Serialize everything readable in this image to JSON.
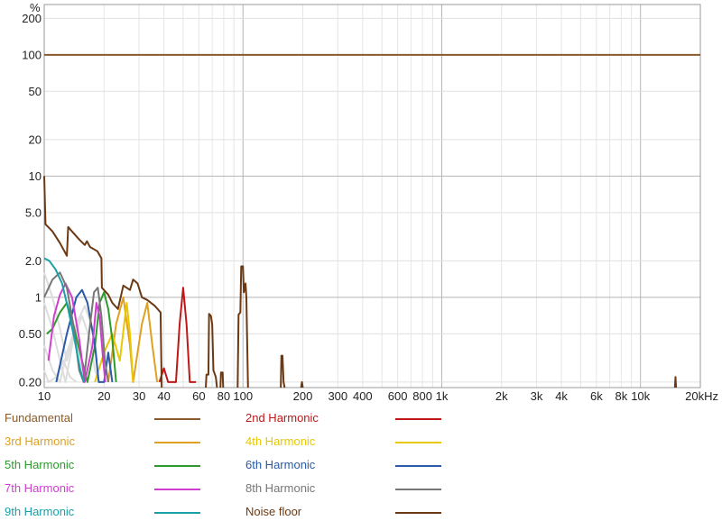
{
  "chart_data": {
    "type": "line",
    "y_unit": "%",
    "x_scale": "log",
    "y_scale": "log",
    "xlim": [
      10,
      20000
    ],
    "ylim": [
      0.18,
      260
    ],
    "x_ticks": [
      {
        "v": 10,
        "label": "10"
      },
      {
        "v": 20,
        "label": "20"
      },
      {
        "v": 30,
        "label": "30"
      },
      {
        "v": 40,
        "label": "40"
      },
      {
        "v": 60,
        "label": "60"
      },
      {
        "v": 80,
        "label": "80"
      },
      {
        "v": 100,
        "label": "100"
      },
      {
        "v": 200,
        "label": "200"
      },
      {
        "v": 300,
        "label": "300"
      },
      {
        "v": 400,
        "label": "400"
      },
      {
        "v": 600,
        "label": "600"
      },
      {
        "v": 800,
        "label": "800"
      },
      {
        "v": 1000,
        "label": "1k"
      },
      {
        "v": 2000,
        "label": "2k"
      },
      {
        "v": 3000,
        "label": "3k"
      },
      {
        "v": 4000,
        "label": "4k"
      },
      {
        "v": 6000,
        "label": "6k"
      },
      {
        "v": 8000,
        "label": "8k"
      },
      {
        "v": 10000,
        "label": "10k"
      },
      {
        "v": 20000,
        "label": "20kHz"
      }
    ],
    "y_ticks": [
      {
        "v": 200,
        "label": "200"
      },
      {
        "v": 100,
        "label": "100"
      },
      {
        "v": 50,
        "label": "50"
      },
      {
        "v": 20,
        "label": "20"
      },
      {
        "v": 10,
        "label": "10"
      },
      {
        "v": 5,
        "label": "5.0"
      },
      {
        "v": 2,
        "label": "2.0"
      },
      {
        "v": 1,
        "label": "1"
      },
      {
        "v": 0.5,
        "label": "0.50"
      },
      {
        "v": 0.2,
        "label": "0.20"
      }
    ],
    "grid": true,
    "legend_position": "bottom",
    "series": [
      {
        "name": "Fundamental",
        "color": "#8a5a2b",
        "points": [
          [
            10,
            100
          ],
          [
            20000,
            100
          ]
        ]
      },
      {
        "name": "2nd Harmonic",
        "color": "#c01818",
        "points": [
          [
            38,
            0.2
          ],
          [
            40,
            0.26
          ],
          [
            42,
            0.2
          ],
          [
            46,
            0.2
          ],
          [
            48,
            0.6
          ],
          [
            50,
            1.2
          ],
          [
            52,
            0.6
          ],
          [
            54,
            0.2
          ],
          [
            58,
            0.2
          ]
        ]
      },
      {
        "name": "3rd Harmonic",
        "color": "#e0a020",
        "points": [
          [
            21,
            0.2
          ],
          [
            23,
            0.6
          ],
          [
            25,
            1.0
          ],
          [
            27,
            0.4
          ],
          [
            28,
            0.2
          ],
          [
            31,
            0.6
          ],
          [
            33,
            0.9
          ],
          [
            35,
            0.4
          ],
          [
            37,
            0.2
          ]
        ]
      },
      {
        "name": "4th Harmonic",
        "color": "#e8c800",
        "points": [
          [
            18,
            0.2
          ],
          [
            20,
            0.35
          ],
          [
            22,
            0.5
          ],
          [
            24,
            0.3
          ],
          [
            26,
            0.9
          ],
          [
            27,
            0.5
          ],
          [
            28,
            0.2
          ]
        ]
      },
      {
        "name": "5th Harmonic",
        "color": "#2e9a2e",
        "points": [
          [
            10.3,
            0.5
          ],
          [
            11,
            0.55
          ],
          [
            12,
            0.75
          ],
          [
            13,
            0.9
          ],
          [
            14,
            0.6
          ],
          [
            15.5,
            0.3
          ],
          [
            16.5,
            0.2
          ],
          [
            18,
            0.4
          ],
          [
            19,
            0.9
          ],
          [
            20,
            1.1
          ],
          [
            21,
            0.8
          ],
          [
            22,
            0.45
          ],
          [
            23,
            0.2
          ]
        ]
      },
      {
        "name": "6th Harmonic",
        "color": "#2a5aa8",
        "points": [
          [
            11.5,
            0.2
          ],
          [
            13,
            0.5
          ],
          [
            14.5,
            1.0
          ],
          [
            15.5,
            1.15
          ],
          [
            16.5,
            0.9
          ],
          [
            18,
            0.4
          ],
          [
            18.8,
            0.2
          ],
          [
            20,
            0.2
          ],
          [
            21,
            0.35
          ],
          [
            22,
            0.2
          ]
        ]
      },
      {
        "name": "7th Harmonic",
        "color": "#d03ed0",
        "points": [
          [
            10.5,
            0.3
          ],
          [
            11.2,
            0.7
          ],
          [
            12,
            1.05
          ],
          [
            12.8,
            1.3
          ],
          [
            13.8,
            1.0
          ],
          [
            15,
            0.45
          ],
          [
            16,
            0.2
          ],
          [
            17.5,
            0.4
          ],
          [
            18.3,
            0.9
          ],
          [
            19,
            0.7
          ],
          [
            19.8,
            0.3
          ],
          [
            20.3,
            0.2
          ]
        ]
      },
      {
        "name": "8th Harmonic",
        "color": "#777777",
        "points": [
          [
            10,
            1.0
          ],
          [
            11,
            1.4
          ],
          [
            12,
            1.6
          ],
          [
            13,
            1.2
          ],
          [
            14,
            0.6
          ],
          [
            15,
            0.25
          ],
          [
            15.8,
            0.2
          ],
          [
            16.8,
            0.5
          ],
          [
            17.8,
            1.1
          ],
          [
            18.6,
            1.2
          ],
          [
            19.4,
            0.7
          ],
          [
            20.2,
            0.3
          ],
          [
            21,
            0.2
          ]
        ]
      },
      {
        "name": "9th Harmonic",
        "color": "#1aa0a8",
        "points": [
          [
            10,
            2.1
          ],
          [
            10.6,
            2.0
          ],
          [
            11.4,
            1.7
          ],
          [
            12.3,
            1.3
          ],
          [
            13.2,
            0.8
          ],
          [
            14.2,
            0.45
          ],
          [
            15.2,
            0.25
          ],
          [
            15.8,
            0.2
          ]
        ]
      },
      {
        "name": "Noise floor",
        "color": "#6b3a14",
        "points": [
          [
            10,
            10
          ],
          [
            10.15,
            4
          ],
          [
            11,
            3.5
          ],
          [
            12,
            2.8
          ],
          [
            13,
            2.2
          ],
          [
            13.2,
            3.8
          ],
          [
            14,
            3.4
          ],
          [
            15,
            3.0
          ],
          [
            16,
            2.7
          ],
          [
            16.4,
            2.9
          ],
          [
            17,
            2.6
          ],
          [
            18.5,
            2.4
          ],
          [
            19.4,
            2.1
          ],
          [
            19.5,
            1.2
          ],
          [
            21,
            1.05
          ],
          [
            22,
            0.9
          ],
          [
            23.5,
            0.8
          ],
          [
            25,
            1.25
          ],
          [
            27,
            1.15
          ],
          [
            28,
            1.4
          ],
          [
            29.5,
            1.3
          ],
          [
            31,
            1.0
          ],
          [
            33,
            0.95
          ],
          [
            36,
            0.85
          ],
          [
            38.5,
            0.75
          ],
          [
            39,
            0.18
          ]
        ]
      },
      {
        "name": "Noise floor",
        "color": "#6b3a14",
        "points": [
          [
            65,
            0.18
          ],
          [
            65.5,
            0.23
          ],
          [
            67,
            0.23
          ],
          [
            67.5,
            0.73
          ],
          [
            69,
            0.7
          ],
          [
            70,
            0.6
          ],
          [
            71,
            0.25
          ],
          [
            73,
            0.22
          ],
          [
            74,
            0.18
          ]
        ]
      },
      {
        "name": "Noise floor",
        "color": "#6b3a14",
        "points": [
          [
            77,
            0.18
          ],
          [
            77.5,
            0.24
          ],
          [
            79,
            0.24
          ],
          [
            79.5,
            0.18
          ]
        ]
      },
      {
        "name": "Noise floor",
        "color": "#6b3a14",
        "points": [
          [
            94,
            0.18
          ],
          [
            95,
            0.72
          ],
          [
            97,
            0.75
          ],
          [
            98,
            1.8
          ],
          [
            100,
            1.8
          ],
          [
            101,
            1.1
          ],
          [
            103,
            1.3
          ],
          [
            104,
            1.0
          ],
          [
            106,
            0.18
          ]
        ]
      },
      {
        "name": "Noise floor",
        "color": "#6b3a14",
        "points": [
          [
            155,
            0.18
          ],
          [
            156,
            0.33
          ],
          [
            158,
            0.33
          ],
          [
            160,
            0.2
          ],
          [
            162,
            0.18
          ]
        ]
      },
      {
        "name": "Noise floor",
        "color": "#6b3a14",
        "points": [
          [
            196,
            0.18
          ],
          [
            198,
            0.2
          ],
          [
            200,
            0.18
          ]
        ]
      },
      {
        "name": "Noise floor",
        "color": "#6b3a14",
        "points": [
          [
            14900,
            0.18
          ],
          [
            15000,
            0.22
          ],
          [
            15100,
            0.18
          ]
        ]
      }
    ],
    "ghost_curves": [
      {
        "color": "#dddddd",
        "points": [
          [
            10,
            0.9
          ],
          [
            11,
            0.55
          ],
          [
            12,
            0.3
          ],
          [
            12.8,
            0.2
          ],
          [
            14,
            0.45
          ],
          [
            15.5,
            0.7
          ],
          [
            17,
            0.45
          ],
          [
            18,
            0.25
          ],
          [
            19,
            0.2
          ]
        ]
      },
      {
        "color": "#dddddd",
        "points": [
          [
            10,
            1.6
          ],
          [
            11,
            1.0
          ],
          [
            12,
            0.55
          ],
          [
            13,
            0.3
          ],
          [
            14.5,
            0.6
          ],
          [
            16,
            0.85
          ],
          [
            17.5,
            0.55
          ],
          [
            18.5,
            0.3
          ]
        ]
      },
      {
        "color": "#dddddd",
        "points": [
          [
            10,
            0.4
          ],
          [
            11,
            0.25
          ],
          [
            12,
            0.2
          ],
          [
            13,
            0.35
          ],
          [
            14,
            0.5
          ],
          [
            15,
            0.35
          ],
          [
            16,
            0.2
          ]
        ]
      },
      {
        "color": "#dddddd",
        "points": [
          [
            10,
            0.25
          ],
          [
            10.5,
            0.2
          ],
          [
            11.5,
            0.22
          ],
          [
            12.5,
            0.3
          ],
          [
            13.5,
            0.22
          ],
          [
            14.5,
            0.2
          ]
        ]
      }
    ]
  },
  "legend": {
    "items": [
      {
        "label": "Fundamental",
        "color": "#8a5a2b"
      },
      {
        "label": "2nd Harmonic",
        "color": "#c01818"
      },
      {
        "label": "3rd Harmonic",
        "color": "#e0a020"
      },
      {
        "label": "4th Harmonic",
        "color": "#e8c800"
      },
      {
        "label": "5th Harmonic",
        "color": "#2e9a2e"
      },
      {
        "label": "6th Harmonic",
        "color": "#2a5aa8"
      },
      {
        "label": "7th Harmonic",
        "color": "#d03ed0"
      },
      {
        "label": "8th Harmonic",
        "color": "#777777"
      },
      {
        "label": "9th Harmonic",
        "color": "#1aa0a8"
      },
      {
        "label": "Noise floor",
        "color": "#6b3a14"
      }
    ]
  }
}
